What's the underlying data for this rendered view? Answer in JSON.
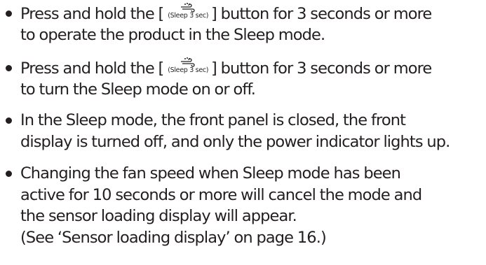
{
  "bullets": [
    {
      "line1_before": "Press and hold the [",
      "button_caption": "(Sleep 3 sec)",
      "line1_after": "] button for 3 seconds or more",
      "line2": "to operate the product in the Sleep mode."
    },
    {
      "line1_before": "Press and hold the [",
      "button_caption": "(Sleep 3 sec)",
      "line1_after": "] button for 3 seconds or more",
      "line2": "to turn the Sleep mode on or off."
    },
    {
      "line1": "In the Sleep mode, the front panel is closed, the front",
      "line2": "display is turned off, and only the power indicator lights up."
    },
    {
      "line1": "Changing the fan speed when Sleep mode has been",
      "line2": "active for 10 seconds or more will cancel the mode and",
      "line3": "the sensor loading display will appear.",
      "line4": "(See ‘Sensor loading display’ on page 16.)"
    }
  ],
  "icons": {
    "sleep_button_icon": "sleep-wind-icon"
  },
  "colors": {
    "text": "#231f20",
    "background": "#ffffff"
  }
}
